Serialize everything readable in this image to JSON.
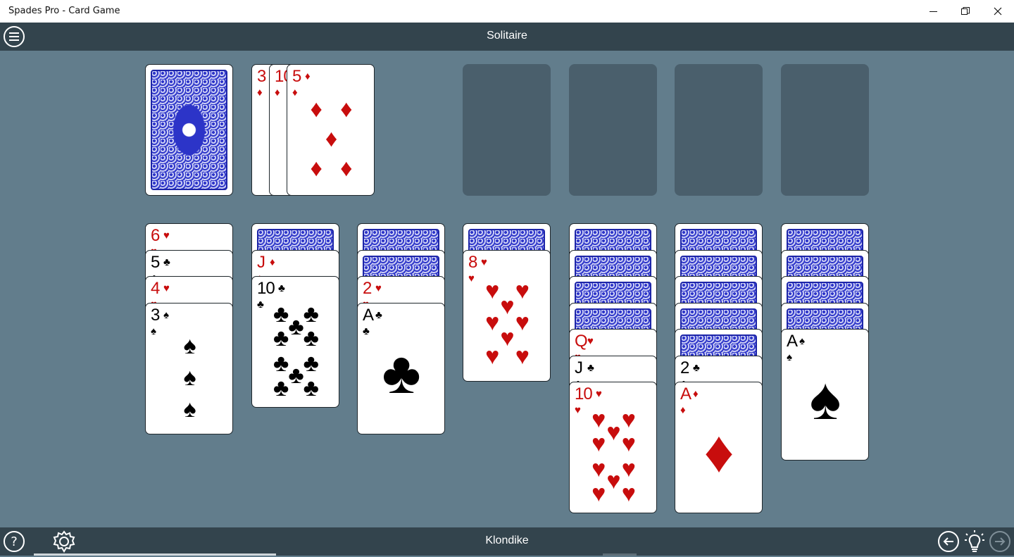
{
  "window": {
    "title": "Spades Pro - Card Game"
  },
  "app": {
    "header_title": "Solitaire",
    "footer_title": "Klondike"
  },
  "colors": {
    "table": "#627d8c",
    "bar": "#33444d",
    "red_suit": "#c80d0d",
    "card_back": "#2d35c6"
  },
  "stock": {
    "face_down": true
  },
  "waste": [
    {
      "rank": "3",
      "suit": "♦"
    },
    {
      "rank": "10",
      "suit": "♦"
    },
    {
      "rank": "5",
      "suit": "♦"
    }
  ],
  "foundations_empty": 4,
  "tableau": [
    {
      "down": 0,
      "up": [
        {
          "rank": "6",
          "suit": "♥"
        },
        {
          "rank": "5",
          "suit": "♣"
        },
        {
          "rank": "4",
          "suit": "♥"
        },
        {
          "rank": "3",
          "suit": "♠"
        }
      ]
    },
    {
      "down": 1,
      "up": [
        {
          "rank": "J",
          "suit": "♦"
        },
        {
          "rank": "10",
          "suit": "♣"
        }
      ]
    },
    {
      "down": 2,
      "up": [
        {
          "rank": "2",
          "suit": "♥"
        },
        {
          "rank": "A",
          "suit": "♣"
        }
      ]
    },
    {
      "down": 1,
      "up": [
        {
          "rank": "8",
          "suit": "♥"
        }
      ]
    },
    {
      "down": 4,
      "up": [
        {
          "rank": "Q",
          "suit": "♥"
        },
        {
          "rank": "J",
          "suit": "♣"
        },
        {
          "rank": "10",
          "suit": "♥"
        }
      ]
    },
    {
      "down": 5,
      "up": [
        {
          "rank": "2",
          "suit": "♣"
        },
        {
          "rank": "A",
          "suit": "♦"
        }
      ]
    },
    {
      "down": 4,
      "up": [
        {
          "rank": "A",
          "suit": "♠"
        }
      ]
    }
  ],
  "icons": {
    "menu": "hamburger-menu-icon",
    "help": "help-icon",
    "settings": "gear-icon",
    "undo": "arrow-left-icon",
    "hint": "lightbulb-icon",
    "redo": "arrow-right-icon"
  }
}
